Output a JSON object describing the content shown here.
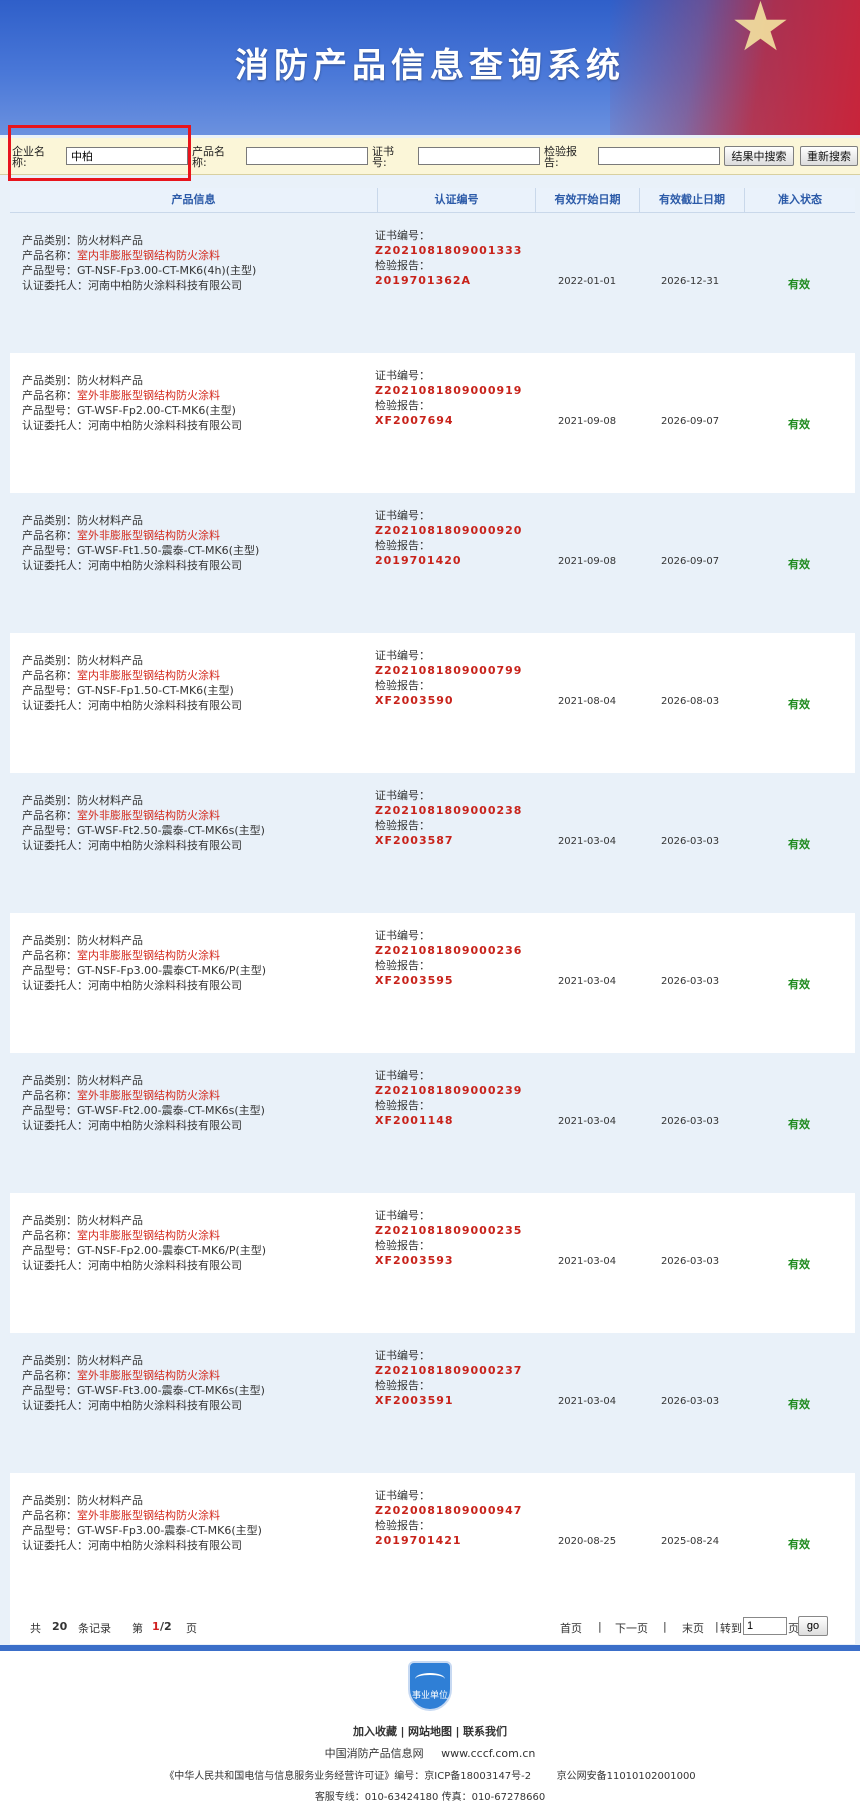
{
  "header": {
    "title": "消防产品信息查询系统"
  },
  "search": {
    "company_label": "企业名称:",
    "company_value": "中柏",
    "product_label": "产品名称:",
    "product_value": "",
    "cert_label": "证书号:",
    "cert_value": "",
    "report_label": "检验报告:",
    "report_value": "",
    "search_within_label": "结果中搜索",
    "research_label": "重新搜索"
  },
  "table": {
    "headers": [
      "产品信息",
      "认证编号",
      "有效开始日期",
      "有效截止日期",
      "准入状态"
    ],
    "field_labels": {
      "category": "产品类别：",
      "name": "产品名称：",
      "model": "产品型号：",
      "client": "认证委托人：",
      "cert_no": "证书编号：",
      "report": "检验报告："
    },
    "rows": [
      {
        "category": "防火材料产品",
        "name": "室内非膨胀型钢结构防火涂料",
        "model": "GT-NSF-Fp3.00-CT-MK6(4h)(主型)",
        "client": "河南中柏防火涂料科技有限公司",
        "cert_no": "Z2021081809001333",
        "report": "2019701362A",
        "start": "2022-01-01",
        "end": "2026-12-31",
        "status": "有效"
      },
      {
        "category": "防火材料产品",
        "name": "室外非膨胀型钢结构防火涂料",
        "model": "GT-WSF-Fp2.00-CT-MK6(主型)",
        "client": "河南中柏防火涂料科技有限公司",
        "cert_no": "Z2021081809000919",
        "report": "XF2007694",
        "start": "2021-09-08",
        "end": "2026-09-07",
        "status": "有效"
      },
      {
        "category": "防火材料产品",
        "name": "室外非膨胀型钢结构防火涂料",
        "model": "GT-WSF-Ft1.50-震泰-CT-MK6(主型)",
        "client": "河南中柏防火涂料科技有限公司",
        "cert_no": "Z2021081809000920",
        "report": "2019701420",
        "start": "2021-09-08",
        "end": "2026-09-07",
        "status": "有效"
      },
      {
        "category": "防火材料产品",
        "name": "室内非膨胀型钢结构防火涂料",
        "model": "GT-NSF-Fp1.50-CT-MK6(主型)",
        "client": "河南中柏防火涂料科技有限公司",
        "cert_no": "Z2021081809000799",
        "report": "XF2003590",
        "start": "2021-08-04",
        "end": "2026-08-03",
        "status": "有效"
      },
      {
        "category": "防火材料产品",
        "name": "室外非膨胀型钢结构防火涂料",
        "model": "GT-WSF-Ft2.50-震泰-CT-MK6s(主型)",
        "client": "河南中柏防火涂料科技有限公司",
        "cert_no": "Z2021081809000238",
        "report": "XF2003587",
        "start": "2021-03-04",
        "end": "2026-03-03",
        "status": "有效"
      },
      {
        "category": "防火材料产品",
        "name": "室内非膨胀型钢结构防火涂料",
        "model": "GT-NSF-Fp3.00-震泰CT-MK6/P(主型)",
        "client": "河南中柏防火涂料科技有限公司",
        "cert_no": "Z2021081809000236",
        "report": "XF2003595",
        "start": "2021-03-04",
        "end": "2026-03-03",
        "status": "有效"
      },
      {
        "category": "防火材料产品",
        "name": "室外非膨胀型钢结构防火涂料",
        "model": "GT-WSF-Ft2.00-震泰-CT-MK6s(主型)",
        "client": "河南中柏防火涂料科技有限公司",
        "cert_no": "Z2021081809000239",
        "report": "XF2001148",
        "start": "2021-03-04",
        "end": "2026-03-03",
        "status": "有效"
      },
      {
        "category": "防火材料产品",
        "name": "室内非膨胀型钢结构防火涂料",
        "model": "GT-NSF-Fp2.00-震泰CT-MK6/P(主型)",
        "client": "河南中柏防火涂料科技有限公司",
        "cert_no": "Z2021081809000235",
        "report": "XF2003593",
        "start": "2021-03-04",
        "end": "2026-03-03",
        "status": "有效"
      },
      {
        "category": "防火材料产品",
        "name": "室外非膨胀型钢结构防火涂料",
        "model": "GT-WSF-Ft3.00-震泰-CT-MK6s(主型)",
        "client": "河南中柏防火涂料科技有限公司",
        "cert_no": "Z2021081809000237",
        "report": "XF2003591",
        "start": "2021-03-04",
        "end": "2026-03-03",
        "status": "有效"
      },
      {
        "category": "防火材料产品",
        "name": "室外非膨胀型钢结构防火涂料",
        "model": "GT-WSF-Fp3.00-震泰-CT-MK6(主型)",
        "client": "河南中柏防火涂料科技有限公司",
        "cert_no": "Z2020081809000947",
        "report": "2019701421",
        "start": "2020-08-25",
        "end": "2025-08-24",
        "status": "有效"
      }
    ]
  },
  "pager": {
    "total_prefix": "共",
    "total": "20",
    "total_suffix": "条记录",
    "page_prefix": "第",
    "current": "1",
    "pages": "/2",
    "page_suffix": "页",
    "first": "首页",
    "next": "下一页",
    "last": "末页",
    "goto_label": "转到",
    "goto_value": "1",
    "goto_suffix": "页",
    "go": "go",
    "sep": "|"
  },
  "footer": {
    "emblem_text": "事业单位",
    "link_favorite": "加入收藏",
    "link_sitemap": "网站地图",
    "link_contact": "联系我们",
    "sep": "|",
    "site_name": "中国消防产品信息网",
    "site_url": "www.cccf.com.cn",
    "license": "《中华人民共和国电信与信息服务业务经营许可证》编号：京ICP备18003147号-2",
    "police": "京公网安备11010102001000",
    "hotline": "客服专线：010-63424180  传真：010-67278660"
  }
}
